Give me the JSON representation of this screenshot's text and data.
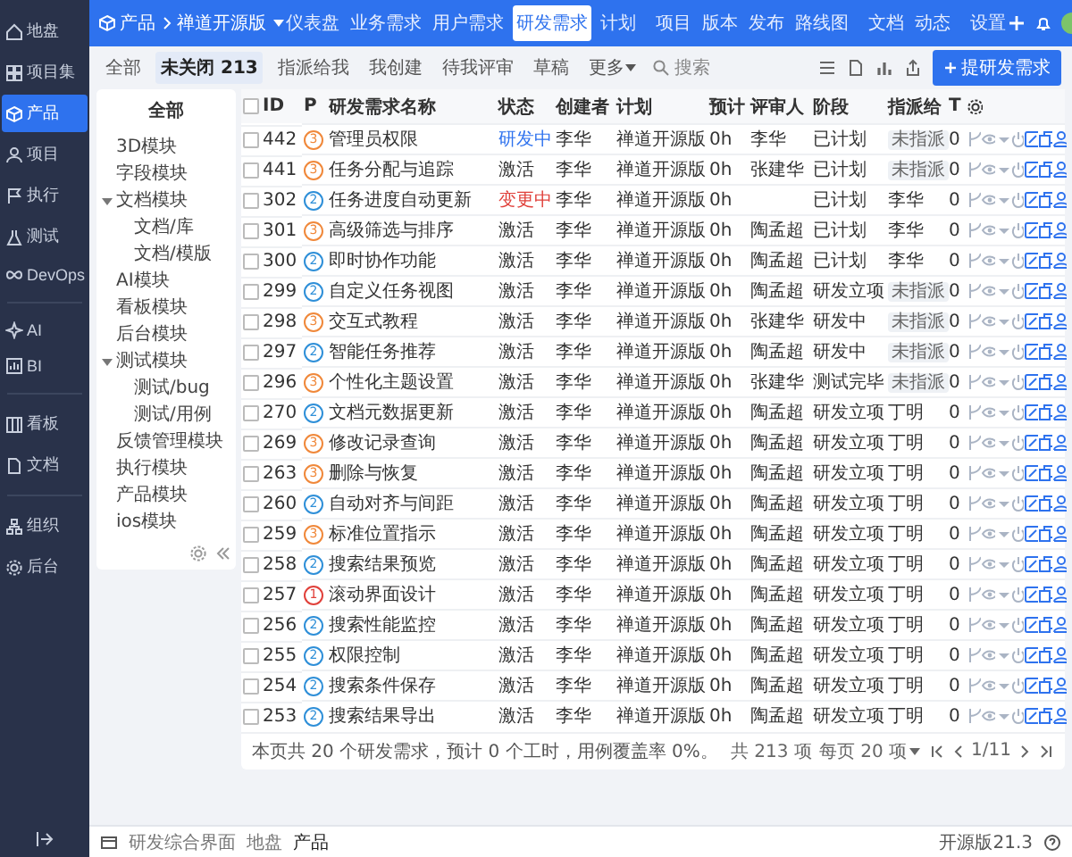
{
  "sidebar": {
    "items": [
      {
        "label": "地盘",
        "selected": false
      },
      {
        "label": "项目集",
        "selected": false
      },
      {
        "label": "产品",
        "selected": true
      },
      {
        "label": "项目",
        "selected": false
      },
      {
        "label": "执行",
        "selected": false
      },
      {
        "label": "测试",
        "selected": false
      },
      {
        "label": "DevOps",
        "selected": false
      },
      {
        "label": "AI",
        "selected": false
      },
      {
        "label": "BI",
        "selected": false
      },
      {
        "label": "看板",
        "selected": false
      },
      {
        "label": "文档",
        "selected": false
      },
      {
        "label": "组织",
        "selected": false
      },
      {
        "label": "后台",
        "selected": false
      }
    ]
  },
  "topbar": {
    "breadcrumb": [
      "产品",
      "禅道开源版"
    ],
    "nav": [
      {
        "label": "仪表盘",
        "selected": false
      },
      {
        "label": "业务需求",
        "selected": false
      },
      {
        "label": "用户需求",
        "selected": false
      },
      {
        "label": "研发需求",
        "selected": true
      },
      {
        "label": "计划",
        "selected": false
      },
      {
        "label": "项目",
        "selected": false
      },
      {
        "label": "版本",
        "selected": false
      },
      {
        "label": "发布",
        "selected": false
      },
      {
        "label": "路线图",
        "selected": false
      },
      {
        "label": "文档",
        "selected": false
      },
      {
        "label": "动态",
        "selected": false
      },
      {
        "label": "设置",
        "selected": false
      }
    ]
  },
  "toolbar": {
    "filters": [
      {
        "label": "全部",
        "selected": false
      },
      {
        "label": "未关闭",
        "count": "213",
        "selected": true
      },
      {
        "label": "指派给我",
        "selected": false
      },
      {
        "label": "我创建",
        "selected": false
      },
      {
        "label": "待我评审",
        "selected": false
      },
      {
        "label": "草稿",
        "selected": false
      }
    ],
    "more": "更多",
    "search": "搜索",
    "create_button": "提研发需求"
  },
  "tree": {
    "title": "全部",
    "items": [
      {
        "label": "3D模块"
      },
      {
        "label": "字段模块"
      },
      {
        "label": "文档模块",
        "expanded": true,
        "children": [
          {
            "label": "文档/库"
          },
          {
            "label": "文档/模版"
          }
        ]
      },
      {
        "label": "AI模块"
      },
      {
        "label": "看板模块"
      },
      {
        "label": "后台模块"
      },
      {
        "label": "测试模块",
        "expanded": true,
        "children": [
          {
            "label": "测试/bug"
          },
          {
            "label": "测试/用例"
          }
        ]
      },
      {
        "label": "反馈管理模块"
      },
      {
        "label": "执行模块"
      },
      {
        "label": "产品模块"
      },
      {
        "label": "ios模块"
      }
    ]
  },
  "table": {
    "select_all": {
      "checked": false
    },
    "columns": [
      "ID",
      "P",
      "研发需求名称",
      "状态",
      "创建者",
      "计划",
      "预计",
      "评审人",
      "阶段",
      "指派给",
      "T"
    ],
    "rows": [
      {
        "checked": false,
        "id": "442",
        "pri": {
          "label": "3",
          "color": "#f0883a"
        },
        "title": "管理员权限",
        "status": {
          "label": "研发中",
          "color": "#2e72ee"
        },
        "creator": "李华",
        "plan": "禅道开源版",
        "estimate": "0h",
        "reviewer": "李华",
        "stage": "已计划",
        "assignee": {
          "label": "未指派",
          "kind": "badge"
        },
        "t": "0"
      },
      {
        "checked": false,
        "id": "441",
        "pri": {
          "label": "3",
          "color": "#f0883a"
        },
        "title": "任务分配与追踪",
        "status": {
          "label": "激活",
          "color": "#333333"
        },
        "creator": "李华",
        "plan": "禅道开源版",
        "estimate": "0h",
        "reviewer": "张建华",
        "stage": "已计划",
        "assignee": {
          "label": "未指派",
          "kind": "badge"
        },
        "t": "0"
      },
      {
        "checked": false,
        "id": "302",
        "pri": {
          "label": "2",
          "color": "#2e8fd8"
        },
        "title": "任务进度自动更新",
        "status": {
          "label": "变更中",
          "color": "#e0403a"
        },
        "creator": "李华",
        "plan": "禅道开源版",
        "estimate": "0h",
        "stage": "已计划",
        "assignee": {
          "label": "李华",
          "kind": "plain"
        },
        "t": "0"
      },
      {
        "checked": false,
        "id": "301",
        "pri": {
          "label": "3",
          "color": "#f0883a"
        },
        "title": "高级筛选与排序",
        "status": {
          "label": "激活",
          "color": "#333333"
        },
        "creator": "李华",
        "plan": "禅道开源版",
        "estimate": "0h",
        "reviewer": "陶孟超",
        "stage": "已计划",
        "assignee": {
          "label": "李华",
          "kind": "plain"
        },
        "t": "0"
      },
      {
        "checked": false,
        "id": "300",
        "pri": {
          "label": "2",
          "color": "#2e8fd8"
        },
        "title": "即时协作功能",
        "status": {
          "label": "激活",
          "color": "#333333"
        },
        "creator": "李华",
        "plan": "禅道开源版",
        "estimate": "0h",
        "reviewer": "陶孟超",
        "stage": "已计划",
        "assignee": {
          "label": "李华",
          "kind": "plain"
        },
        "t": "0"
      },
      {
        "checked": false,
        "id": "299",
        "pri": {
          "label": "2",
          "color": "#2e8fd8"
        },
        "title": "自定义任务视图",
        "status": {
          "label": "激活",
          "color": "#333333"
        },
        "creator": "李华",
        "plan": "禅道开源版",
        "estimate": "0h",
        "reviewer": "陶孟超",
        "stage": "研发立项",
        "assignee": {
          "label": "未指派",
          "kind": "badge"
        },
        "t": "0"
      },
      {
        "checked": false,
        "id": "298",
        "pri": {
          "label": "3",
          "color": "#f0883a"
        },
        "title": "交互式教程",
        "status": {
          "label": "激活",
          "color": "#333333"
        },
        "creator": "李华",
        "plan": "禅道开源版",
        "estimate": "0h",
        "reviewer": "张建华",
        "stage": "研发中",
        "assignee": {
          "label": "未指派",
          "kind": "badge"
        },
        "t": "0"
      },
      {
        "checked": false,
        "id": "297",
        "pri": {
          "label": "2",
          "color": "#2e8fd8"
        },
        "title": "智能任务推荐",
        "status": {
          "label": "激活",
          "color": "#333333"
        },
        "creator": "李华",
        "plan": "禅道开源版",
        "estimate": "0h",
        "reviewer": "陶孟超",
        "stage": "研发中",
        "assignee": {
          "label": "未指派",
          "kind": "badge"
        },
        "t": "0"
      },
      {
        "checked": false,
        "id": "296",
        "pri": {
          "label": "3",
          "color": "#f0883a"
        },
        "title": "个性化主题设置",
        "status": {
          "label": "激活",
          "color": "#333333"
        },
        "creator": "李华",
        "plan": "禅道开源版",
        "estimate": "0h",
        "reviewer": "张建华",
        "stage": "测试完毕",
        "assignee": {
          "label": "未指派",
          "kind": "badge"
        },
        "t": "0"
      },
      {
        "checked": false,
        "id": "270",
        "pri": {
          "label": "2",
          "color": "#2e8fd8"
        },
        "title": "文档元数据更新",
        "status": {
          "label": "激活",
          "color": "#333333"
        },
        "creator": "李华",
        "plan": "禅道开源版",
        "estimate": "0h",
        "reviewer": "陶孟超",
        "stage": "研发立项",
        "assignee": {
          "label": "丁明",
          "kind": "plain"
        },
        "t": "0"
      },
      {
        "checked": false,
        "id": "269",
        "pri": {
          "label": "3",
          "color": "#f0883a"
        },
        "title": "修改记录查询",
        "status": {
          "label": "激活",
          "color": "#333333"
        },
        "creator": "李华",
        "plan": "禅道开源版",
        "estimate": "0h",
        "reviewer": "陶孟超",
        "stage": "研发立项",
        "assignee": {
          "label": "丁明",
          "kind": "plain"
        },
        "t": "0"
      },
      {
        "checked": false,
        "id": "263",
        "pri": {
          "label": "3",
          "color": "#f0883a"
        },
        "title": "删除与恢复",
        "status": {
          "label": "激活",
          "color": "#333333"
        },
        "creator": "李华",
        "plan": "禅道开源版",
        "estimate": "0h",
        "reviewer": "陶孟超",
        "stage": "研发立项",
        "assignee": {
          "label": "丁明",
          "kind": "plain"
        },
        "t": "0"
      },
      {
        "checked": false,
        "id": "260",
        "pri": {
          "label": "2",
          "color": "#2e8fd8"
        },
        "title": "自动对齐与间距",
        "status": {
          "label": "激活",
          "color": "#333333"
        },
        "creator": "李华",
        "plan": "禅道开源版",
        "estimate": "0h",
        "reviewer": "陶孟超",
        "stage": "研发立项",
        "assignee": {
          "label": "丁明",
          "kind": "plain"
        },
        "t": "0"
      },
      {
        "checked": false,
        "id": "259",
        "pri": {
          "label": "3",
          "color": "#f0883a"
        },
        "title": "标准位置指示",
        "status": {
          "label": "激活",
          "color": "#333333"
        },
        "creator": "李华",
        "plan": "禅道开源版",
        "estimate": "0h",
        "reviewer": "陶孟超",
        "stage": "研发立项",
        "assignee": {
          "label": "丁明",
          "kind": "plain"
        },
        "t": "0"
      },
      {
        "checked": false,
        "id": "258",
        "pri": {
          "label": "2",
          "color": "#2e8fd8"
        },
        "title": "搜索结果预览",
        "status": {
          "label": "激活",
          "color": "#333333"
        },
        "creator": "李华",
        "plan": "禅道开源版",
        "estimate": "0h",
        "reviewer": "陶孟超",
        "stage": "研发立项",
        "assignee": {
          "label": "丁明",
          "kind": "plain"
        },
        "t": "0"
      },
      {
        "checked": false,
        "id": "257",
        "pri": {
          "label": "1",
          "color": "#e0403a"
        },
        "title": "滚动界面设计",
        "status": {
          "label": "激活",
          "color": "#333333"
        },
        "creator": "李华",
        "plan": "禅道开源版",
        "estimate": "0h",
        "reviewer": "陶孟超",
        "stage": "研发立项",
        "assignee": {
          "label": "丁明",
          "kind": "plain"
        },
        "t": "0"
      },
      {
        "checked": false,
        "id": "256",
        "pri": {
          "label": "2",
          "color": "#2e8fd8"
        },
        "title": "搜索性能监控",
        "status": {
          "label": "激活",
          "color": "#333333"
        },
        "creator": "李华",
        "plan": "禅道开源版",
        "estimate": "0h",
        "reviewer": "陶孟超",
        "stage": "研发立项",
        "assignee": {
          "label": "丁明",
          "kind": "plain"
        },
        "t": "0"
      },
      {
        "checked": false,
        "id": "255",
        "pri": {
          "label": "2",
          "color": "#2e8fd8"
        },
        "title": "权限控制",
        "status": {
          "label": "激活",
          "color": "#333333"
        },
        "creator": "李华",
        "plan": "禅道开源版",
        "estimate": "0h",
        "reviewer": "陶孟超",
        "stage": "研发立项",
        "assignee": {
          "label": "丁明",
          "kind": "plain"
        },
        "t": "0"
      },
      {
        "checked": false,
        "id": "254",
        "pri": {
          "label": "2",
          "color": "#2e8fd8"
        },
        "title": "搜索条件保存",
        "status": {
          "label": "激活",
          "color": "#333333"
        },
        "creator": "李华",
        "plan": "禅道开源版",
        "estimate": "0h",
        "reviewer": "陶孟超",
        "stage": "研发立项",
        "assignee": {
          "label": "丁明",
          "kind": "plain"
        },
        "t": "0"
      },
      {
        "checked": false,
        "id": "253",
        "pri": {
          "label": "2",
          "color": "#2e8fd8"
        },
        "title": "搜索结果导出",
        "status": {
          "label": "激活",
          "color": "#333333"
        },
        "creator": "李华",
        "plan": "禅道开源版",
        "estimate": "0h",
        "reviewer": "陶孟超",
        "stage": "研发立项",
        "assignee": {
          "label": "丁明",
          "kind": "plain"
        },
        "t": "0"
      }
    ],
    "summary": "本页共 20 个研发需求，预计 0 个工时，用例覆盖率 0%。",
    "pagination": {
      "total": "共 213 项",
      "per_page": "每页 20 项",
      "page": "1/11"
    }
  },
  "status_bar": {
    "crumbs": [
      "研发综合界面",
      "地盘",
      "产品"
    ],
    "version": "开源版21.3"
  }
}
